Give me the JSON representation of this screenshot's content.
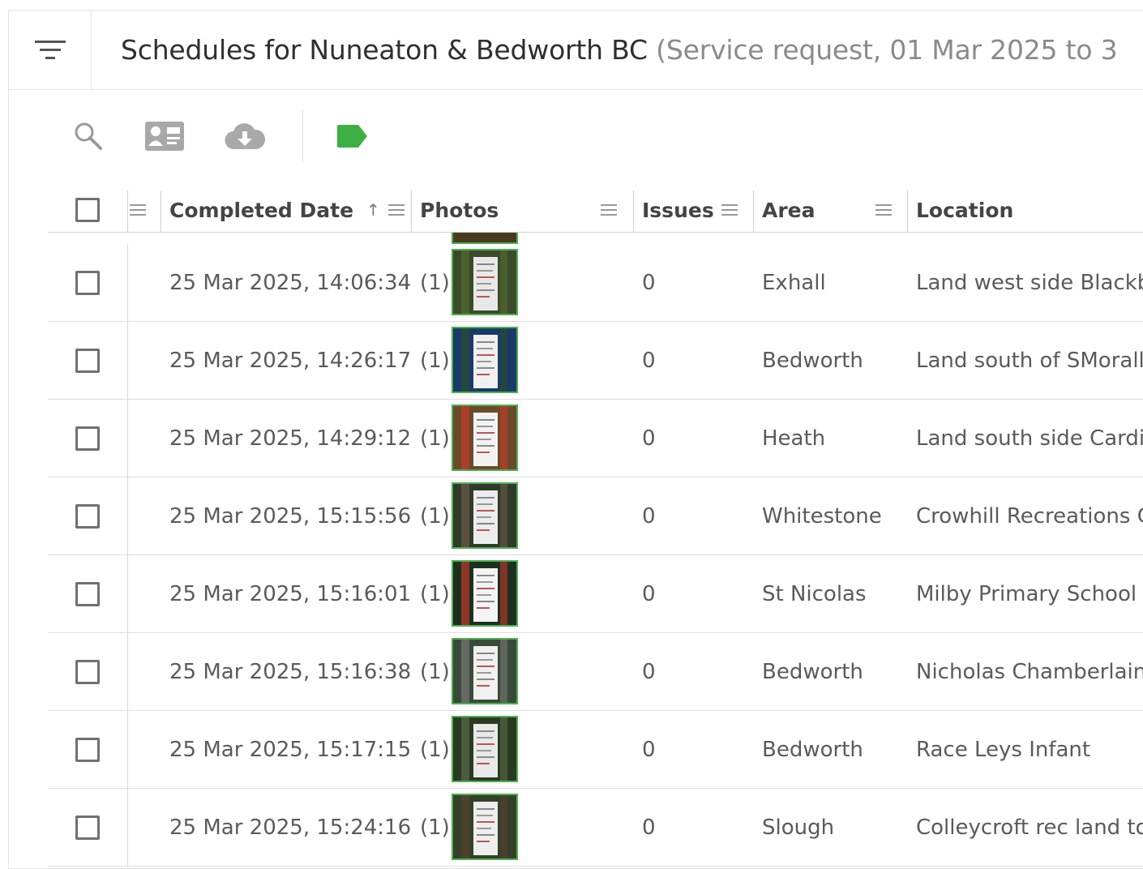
{
  "header": {
    "title": "Schedules for Nuneaton & Bedworth BC",
    "subtitle": "(Service request, 01 Mar 2025 to 3"
  },
  "toolbar": {
    "icons": [
      "search-icon",
      "contact-card-icon",
      "cloud-download-icon",
      "tag-icon"
    ],
    "accent": "#3cb043"
  },
  "columns": {
    "completed": "Completed Date",
    "sort_arrow": "↑",
    "photos": "Photos",
    "issues": "Issues",
    "area": "Area",
    "location": "Location"
  },
  "rows": [
    {
      "date": "25 Mar 2025, 14:06:34",
      "photo_count": "(1)",
      "issues": "0",
      "area": "Exhall",
      "location": "Land west side Blackb"
    },
    {
      "date": "25 Mar 2025, 14:26:17",
      "photo_count": "(1)",
      "issues": "0",
      "area": "Bedworth",
      "location": "Land south of SMorall"
    },
    {
      "date": "25 Mar 2025, 14:29:12",
      "photo_count": "(1)",
      "issues": "0",
      "area": "Heath",
      "location": "Land south side Cardi"
    },
    {
      "date": "25 Mar 2025, 15:15:56",
      "photo_count": "(1)",
      "issues": "0",
      "area": "Whitestone",
      "location": "Crowhill Recreations G"
    },
    {
      "date": "25 Mar 2025, 15:16:01",
      "photo_count": "(1)",
      "issues": "0",
      "area": "St Nicolas",
      "location": "Milby Primary School"
    },
    {
      "date": "25 Mar 2025, 15:16:38",
      "photo_count": "(1)",
      "issues": "0",
      "area": "Bedworth",
      "location": "Nicholas Chamberlain"
    },
    {
      "date": "25 Mar 2025, 15:17:15",
      "photo_count": "(1)",
      "issues": "0",
      "area": "Bedworth",
      "location": "Race Leys Infant"
    },
    {
      "date": "25 Mar 2025, 15:24:16",
      "photo_count": "(1)",
      "issues": "0",
      "area": "Slough",
      "location": "Colleycroft rec land to"
    }
  ]
}
